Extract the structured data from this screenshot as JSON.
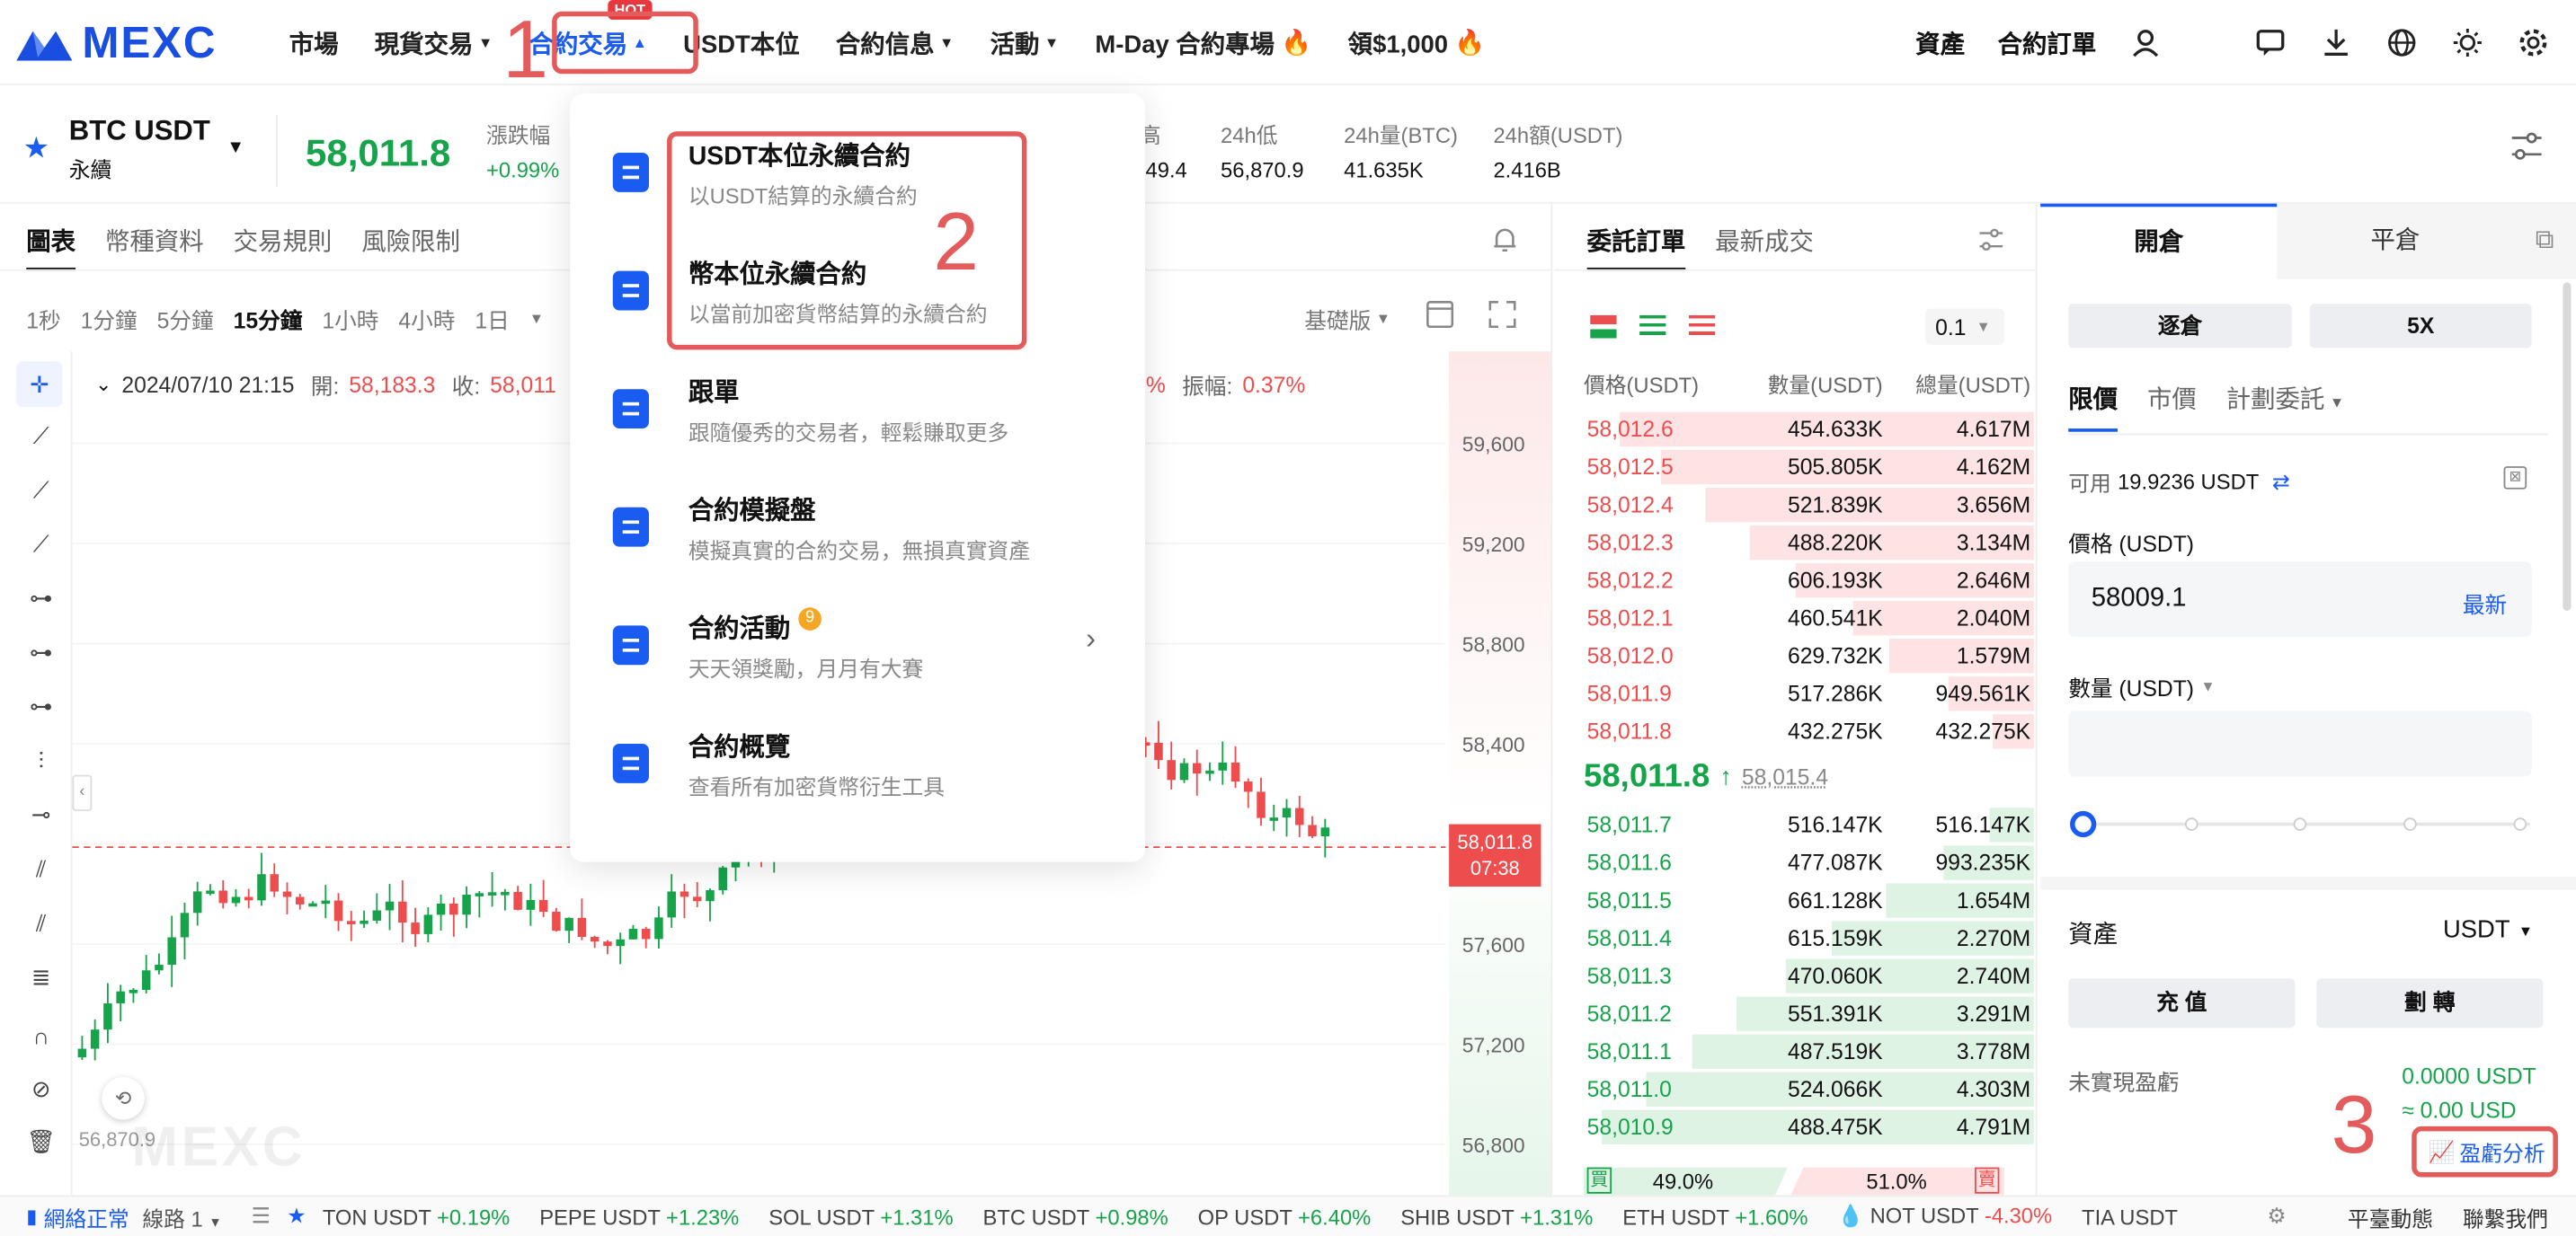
{
  "header": {
    "logo": "MEXC",
    "nav": [
      {
        "label": "市場",
        "caret": false
      },
      {
        "label": "現貨交易",
        "caret": true
      },
      {
        "label": "合約交易",
        "caret": true
      },
      {
        "label": "USDT本位",
        "caret": false
      },
      {
        "label": "合約信息",
        "caret": true
      },
      {
        "label": "活動",
        "caret": true
      },
      {
        "label": "M-Day 合約專場",
        "caret": false,
        "fire": true
      },
      {
        "label": "領$1,000",
        "caret": false,
        "fire": true
      }
    ],
    "hot_badge": "HOT",
    "right": [
      "資產",
      "合約訂單"
    ]
  },
  "ticker": {
    "pair": "BTC USDT",
    "type": "永續",
    "price": "58,011.8",
    "change_label": "漲跌幅",
    "change": "+0.99%",
    "stats": [
      {
        "label": "24h高",
        "value": "58,349.4"
      },
      {
        "label": "24h低",
        "value": "56,870.9"
      },
      {
        "label": "24h量(BTC)",
        "value": "41.635K"
      },
      {
        "label": "24h額(USDT)",
        "value": "2.416B"
      }
    ]
  },
  "chart_tabs": [
    "圖表",
    "幣種資料",
    "交易規則",
    "風險限制"
  ],
  "intervals": [
    "1秒",
    "1分鐘",
    "5分鐘",
    "15分鐘",
    "1小時",
    "4小時",
    "1日"
  ],
  "active_interval": "15分鐘",
  "chart_mode": "基礎版",
  "ohlc": {
    "date": "2024/07/10 21:15",
    "open_label": "開:",
    "open": "58,183.3",
    "close_label": "收:",
    "close": "58,011",
    "pct": "9%",
    "amp_label": "振幅:",
    "amp": "0.37%"
  },
  "price_axis": [
    "59,600",
    "59,200",
    "58,800",
    "58,400",
    "58,000",
    "57,600",
    "57,200",
    "56,800"
  ],
  "price_tag": {
    "price": "58,011.8",
    "countdown": "07:38"
  },
  "chart_low": "56,870.9",
  "watermark": "MEXC",
  "dropdown": {
    "items": [
      {
        "title": "USDT本位永續合約",
        "desc": "以USDT結算的永續合約"
      },
      {
        "title": "幣本位永續合約",
        "desc": "以當前加密貨幣結算的永續合約"
      },
      {
        "title": "跟單",
        "desc": "跟隨優秀的交易者，輕鬆賺取更多"
      },
      {
        "title": "合約模擬盤",
        "desc": "模擬真實的合約交易，無損真實資產"
      },
      {
        "title": "合約活動",
        "desc": "天天領獎勵，月月有大賽",
        "badge": "9"
      },
      {
        "title": "合約概覽",
        "desc": "查看所有加密貨幣衍生工具"
      }
    ]
  },
  "orderbook": {
    "tabs": [
      "委託訂單",
      "最新成交"
    ],
    "precision": "0.1",
    "headers": [
      "價格(USDT)",
      "數量(USDT)",
      "總量(USDT)"
    ],
    "asks": [
      [
        "58,012.6",
        "454.633K",
        "4.617M",
        0.92
      ],
      [
        "58,012.5",
        "505.805K",
        "4.162M",
        0.83
      ],
      [
        "58,012.4",
        "521.839K",
        "3.656M",
        0.73
      ],
      [
        "58,012.3",
        "488.220K",
        "3.134M",
        0.63
      ],
      [
        "58,012.2",
        "606.193K",
        "2.646M",
        0.53
      ],
      [
        "58,012.1",
        "460.541K",
        "2.040M",
        0.4
      ],
      [
        "58,012.0",
        "629.732K",
        "1.579M",
        0.32
      ],
      [
        "58,011.9",
        "517.286K",
        "949.561K",
        0.19
      ],
      [
        "58,011.8",
        "432.275K",
        "432.275K",
        0.09
      ]
    ],
    "mid_price": "58,011.8",
    "mid_mark": "58,015.4",
    "bids": [
      [
        "58,011.7",
        "516.147K",
        "516.147K",
        0.1
      ],
      [
        "58,011.6",
        "477.087K",
        "993.235K",
        0.2
      ],
      [
        "58,011.5",
        "661.128K",
        "1.654M",
        0.33
      ],
      [
        "58,011.4",
        "615.159K",
        "2.270M",
        0.45
      ],
      [
        "58,011.3",
        "470.060K",
        "2.740M",
        0.55
      ],
      [
        "58,011.2",
        "551.391K",
        "3.291M",
        0.66
      ],
      [
        "58,011.1",
        "487.519K",
        "3.778M",
        0.76
      ],
      [
        "58,011.0",
        "524.066K",
        "4.303M",
        0.86
      ],
      [
        "58,010.9",
        "488.475K",
        "4.791M",
        0.96
      ]
    ],
    "buy_label": "買",
    "buy_pct": "49.0%",
    "sell_pct": "51.0%",
    "sell_label": "賣"
  },
  "trade": {
    "tabs": [
      "開倉",
      "平倉"
    ],
    "margin_mode": "逐倉",
    "leverage": "5X",
    "order_types": [
      "限價",
      "市價",
      "計劃委託"
    ],
    "available_label": "可用",
    "available": "19.9236 USDT",
    "price_label": "價格 (USDT)",
    "price_value": "58009.1",
    "latest": "最新",
    "qty_label": "數量 (USDT)",
    "assets_label": "資產",
    "asset_unit": "USDT",
    "deposit": "充 值",
    "transfer": "劃 轉",
    "pnl_label": "未實現盈虧",
    "pnl_value": "0.0000 USDT",
    "pnl_usd": "≈ 0.00 USD",
    "pnl_analysis": "盈虧分析"
  },
  "annotations": [
    "1",
    "2",
    "3"
  ],
  "footer": {
    "network": "網絡正常",
    "route": "線路 1",
    "coins": [
      {
        "name": "TON USDT",
        "chg": "+0.19%",
        "up": true
      },
      {
        "name": "PEPE USDT",
        "chg": "+1.23%",
        "up": true
      },
      {
        "name": "SOL USDT",
        "chg": "+1.31%",
        "up": true
      },
      {
        "name": "BTC USDT",
        "chg": "+0.98%",
        "up": true
      },
      {
        "name": "OP USDT",
        "chg": "+6.40%",
        "up": true
      },
      {
        "name": "SHIB USDT",
        "chg": "+1.31%",
        "up": true
      },
      {
        "name": "ETH USDT",
        "chg": "+1.60%",
        "up": true
      },
      {
        "name": "NOT USDT",
        "chg": "-4.30%",
        "up": false
      },
      {
        "name": "TIA USDT",
        "chg": "",
        "up": true
      }
    ],
    "right": [
      "平臺動態",
      "聯繫我們"
    ]
  }
}
